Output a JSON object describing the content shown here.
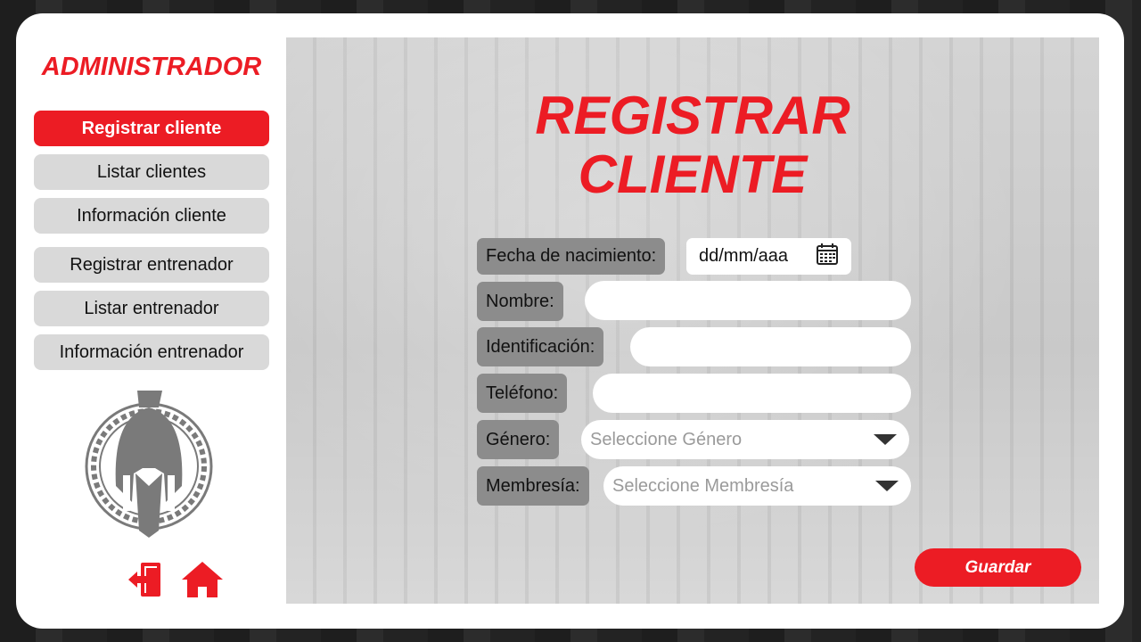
{
  "sidebar": {
    "title": "ADMINISTRADOR",
    "items": [
      {
        "label": "Registrar cliente",
        "active": true
      },
      {
        "label": "Listar clientes",
        "active": false
      },
      {
        "label": "Información cliente",
        "active": false
      },
      {
        "label": "Registrar entrenador",
        "active": false
      },
      {
        "label": "Listar entrenador",
        "active": false
      },
      {
        "label": "Información entrenador",
        "active": false
      }
    ],
    "logo_icon": "spartan-helmet-icon",
    "bottom_icons": [
      "logout-icon",
      "home-icon"
    ]
  },
  "main": {
    "title_line1": "REGISTRAR",
    "title_line2": "CLIENTE",
    "form": {
      "birth_date": {
        "label": "Fecha de nacimiento:",
        "value": "dd/mm/aaa",
        "icon": "calendar-icon"
      },
      "name": {
        "label": "Nombre:",
        "value": ""
      },
      "identification": {
        "label": "Identificación:",
        "value": ""
      },
      "phone": {
        "label": "Teléfono:",
        "value": ""
      },
      "gender": {
        "label": "Género:",
        "placeholder": "Seleccione Género"
      },
      "membership": {
        "label": "Membresía:",
        "placeholder": "Seleccione Membresía"
      }
    },
    "save_label": "Guardar"
  },
  "colors": {
    "accent": "#ec1c24",
    "nav_inactive": "#d9d9d9",
    "label_bg": "#8c8c8c",
    "panel_bg": "#cfcfcf"
  }
}
